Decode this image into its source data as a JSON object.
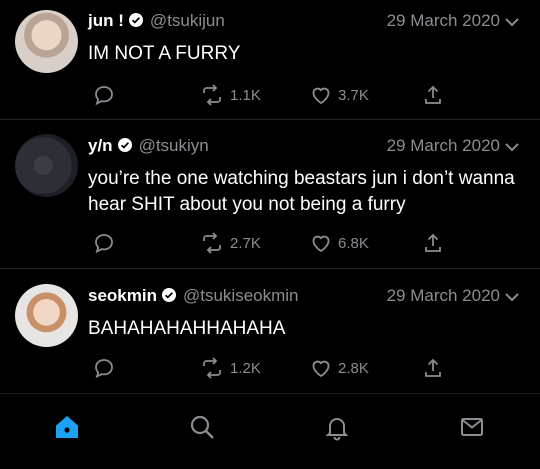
{
  "tweets": [
    {
      "name": "jun !",
      "handle": "@tsukijun",
      "date": "29 March 2020",
      "text": "IM NOT A FURRY",
      "retweets": "1.1K",
      "likes": "3.7K"
    },
    {
      "name": "y/n",
      "handle": "@tsukiyn",
      "date": "29 March 2020",
      "text": "you’re the one watching beastars jun i don’t wanna hear SHIT about you not being a furry",
      "retweets": "2.7K",
      "likes": "6.8K"
    },
    {
      "name": "seokmin",
      "handle": "@tsukiseokmin",
      "date": "29 March 2020",
      "text": "BAHAHAHAHHAHAHA",
      "retweets": "1.2K",
      "likes": "2.8K"
    }
  ],
  "colors": {
    "accent": "#1da1f2",
    "text": "#ffffff",
    "muted": "#8a8d91",
    "background": "#000000"
  },
  "nav": {
    "items": [
      "home-icon",
      "search-icon",
      "notifications-icon",
      "messages-icon"
    ],
    "active": "home-icon"
  }
}
